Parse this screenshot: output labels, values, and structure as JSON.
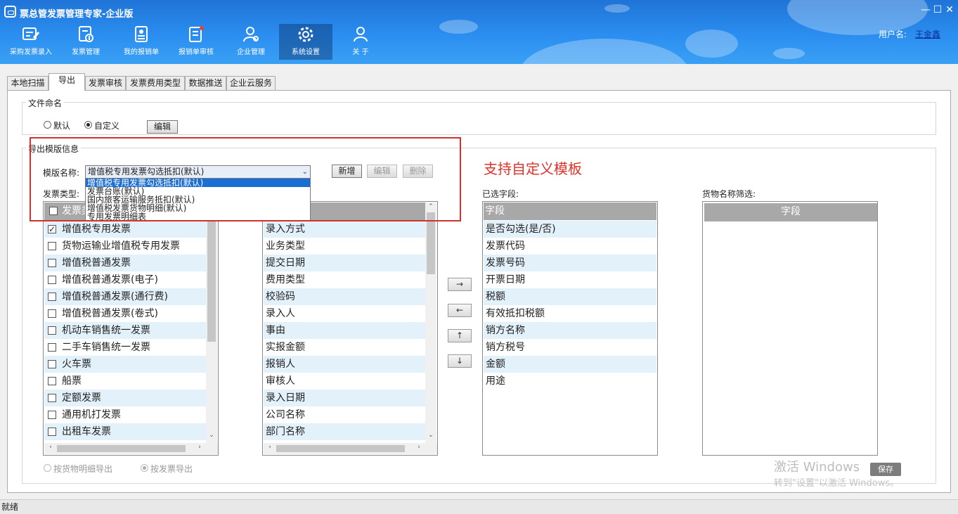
{
  "app": {
    "title": "票总管发票管理专家-企业版",
    "user_label": "用户名:",
    "user_name": "王金鑫"
  },
  "window_controls": {
    "minimize": "—",
    "maximize": "☐",
    "close": "✕"
  },
  "nav": [
    {
      "label": "采购发票录入",
      "icon": "invoice-entry-icon"
    },
    {
      "label": "发票管理",
      "icon": "invoice-manage-icon"
    },
    {
      "label": "我的报销单",
      "icon": "expense-report-icon"
    },
    {
      "label": "报销单审核",
      "icon": "report-audit-icon"
    },
    {
      "label": "企业管理",
      "icon": "company-user-icon"
    },
    {
      "label": "系统设置",
      "icon": "gear-icon"
    },
    {
      "label": "关 于",
      "icon": "about-user-icon"
    }
  ],
  "tabs": [
    "本地扫描",
    "导出",
    "发票审核",
    "发票费用类型",
    "数据推送",
    "企业云服务"
  ],
  "naming": {
    "group_title": "文件命名",
    "radio_default": "默认",
    "radio_custom": "自定义",
    "edit_button": "编辑"
  },
  "template": {
    "group_title": "导出模版信息",
    "name_label": "模版名称:",
    "selected": "增值税专用发票勾选抵扣(默认)",
    "options": [
      "增值税专用发票勾选抵扣(默认)",
      "发票台账(默认)",
      "国内旅客运输服务抵扣(默认)",
      "增值税发票货物明细(默认)",
      "专用发票明细表"
    ],
    "new_button": "新增",
    "edit_button": "编辑",
    "delete_button": "删除"
  },
  "promo": "支持自定义模板",
  "invoice_types": {
    "label": "发票类型:",
    "header": "发票类型",
    "items": [
      "增值税专用发票",
      "货物运输业增值税专用发票",
      "增值税普通发票",
      "增值税普通发票(电子)",
      "增值税普通发票(通行费)",
      "增值税普通发票(卷式)",
      "机动车销售统一发票",
      "二手车销售统一发票",
      "火车票",
      "船票",
      "定额发票",
      "通用机打发票",
      "出租车发票"
    ],
    "checked": [
      true,
      false,
      false,
      false,
      false,
      false,
      false,
      false,
      false,
      false,
      false,
      false,
      false
    ]
  },
  "available_fields": {
    "items": [
      "录入方式",
      "业务类型",
      "提交日期",
      "费用类型",
      "校验码",
      "录入人",
      "事由",
      "实报金额",
      "报销人",
      "审核人",
      "录入日期",
      "公司名称",
      "部门名称"
    ]
  },
  "move_buttons": {
    "right": "→",
    "left": "←",
    "up": "↑",
    "down": "↓"
  },
  "selected_fields": {
    "label": "已选字段:",
    "header": "字段",
    "items": [
      "是否勾选(是/否)",
      "发票代码",
      "发票号码",
      "开票日期",
      "税额",
      "有效抵扣税额",
      "销方名称",
      "销方税号",
      "金额",
      "用途"
    ]
  },
  "goods_filter": {
    "label": "货物名称筛选:",
    "header": "字段"
  },
  "export_mode": {
    "by_goods": "按货物明细导出",
    "by_invoice": "按发票导出"
  },
  "watermark": {
    "line1": "激活 Windows",
    "line2": "转到\"设置\"以激活 Windows。"
  },
  "save_button": "保存",
  "status": "就绪"
}
